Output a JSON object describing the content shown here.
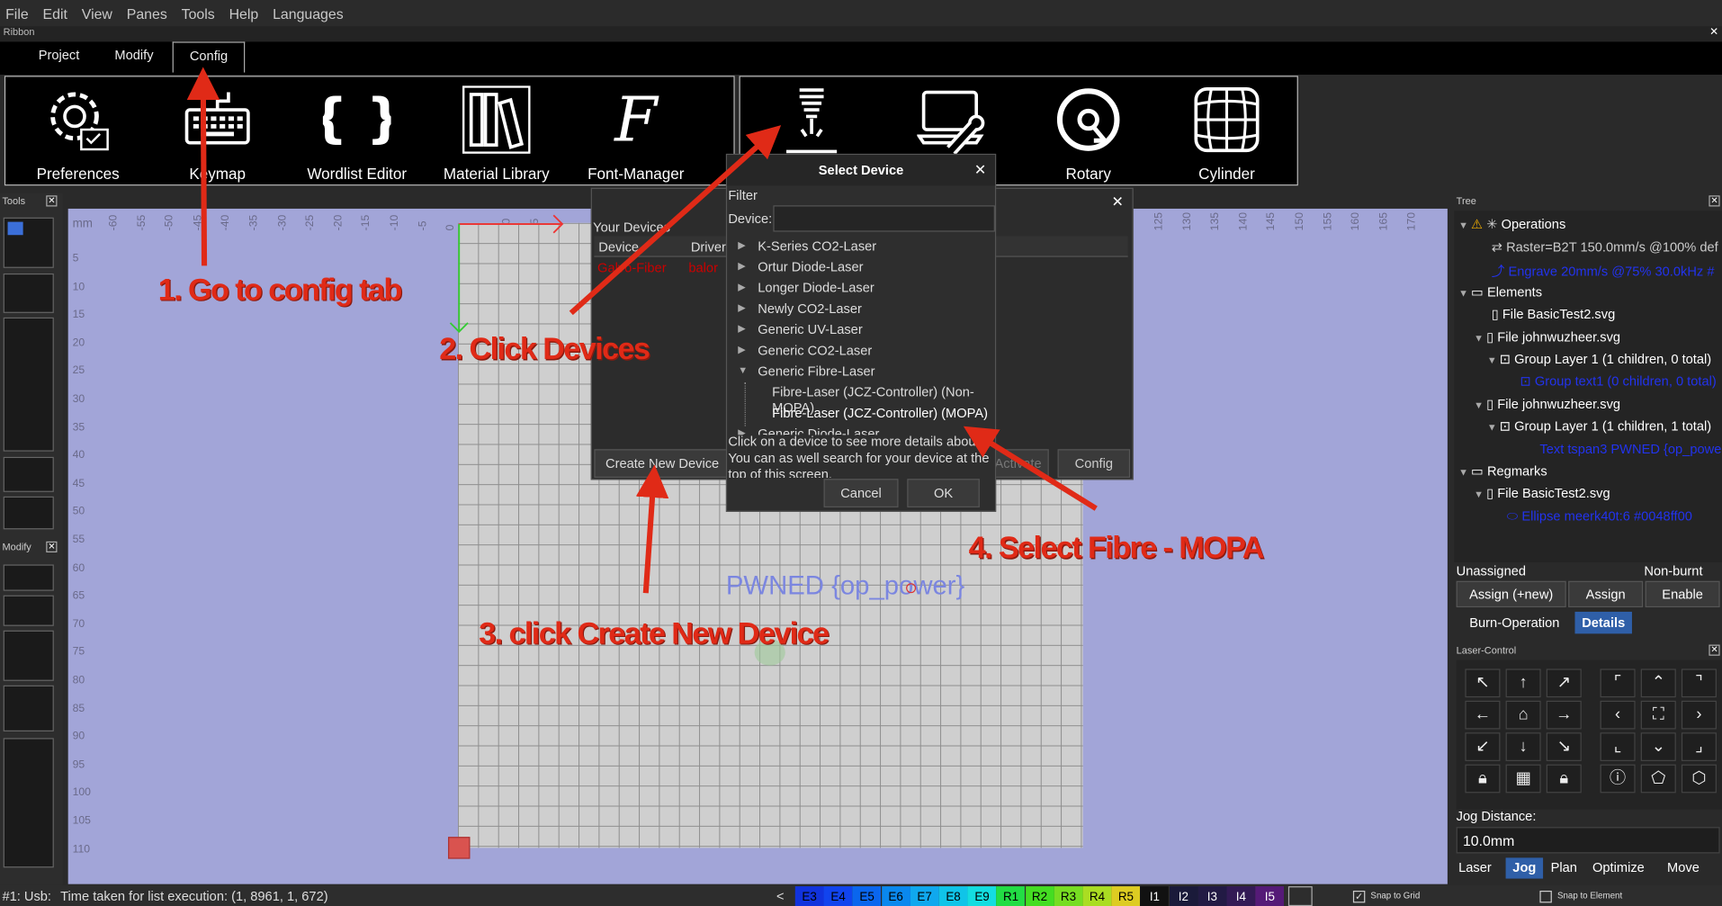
{
  "menu": [
    "File",
    "Edit",
    "View",
    "Panes",
    "Tools",
    "Help",
    "Languages"
  ],
  "ribbon_label": "Ribbon",
  "tabs": [
    "Project",
    "Modify",
    "Config"
  ],
  "ribbon_buttons": [
    "Preferences",
    "Keymap",
    "Wordlist Editor",
    "Material Library",
    "Font-Manager",
    "",
    "Rotary",
    "Cylinder"
  ],
  "tools_label": "Tools",
  "modify_label": "Modify",
  "ruler": {
    "unit": "mm",
    "top": [
      "-60",
      "-55",
      "-50",
      "-45",
      "-40",
      "-35",
      "-30",
      "-25",
      "-20",
      "-15",
      "-10",
      "-5",
      "0",
      "5",
      "10",
      "15",
      "125",
      "130",
      "135",
      "140",
      "145",
      "150",
      "155",
      "160",
      "165",
      "170"
    ],
    "left": [
      "5",
      "10",
      "15",
      "20",
      "25",
      "30",
      "35",
      "40",
      "45",
      "50",
      "55",
      "60",
      "65",
      "70",
      "75",
      "80",
      "85",
      "90",
      "95",
      "100",
      "105",
      "110"
    ]
  },
  "canvas_text": "PWNED {op_power}",
  "devices_dialog": {
    "title": "Your Devices",
    "col_device": "Device",
    "col_driver": "Driver",
    "row_device": "Galvo-Fiber",
    "row_driver": "balor",
    "create_btn": "Create New Device",
    "activate_btn": "Activate",
    "config_btn": "Config"
  },
  "select_dialog": {
    "title": "Select Device",
    "filter": "Filter",
    "device_label": "Device:",
    "items": [
      "K-Series CO2-Laser",
      "Ortur Diode-Laser",
      "Longer Diode-Laser",
      "Newly CO2-Laser",
      "Generic UV-Laser",
      "Generic CO2-Laser",
      "Generic Fibre-Laser"
    ],
    "children": [
      "Fibre-Laser (JCZ-Controller) (Non-MOPA)",
      "Fibre-Laser (JCZ-Controller) (MOPA)"
    ],
    "partial_item": "Generic Diode-Laser",
    "info": "Click on a device to see more details about it. You can as well search for your device at the top of this screen.",
    "cancel": "Cancel",
    "ok": "OK"
  },
  "tree": {
    "label": "Tree",
    "operations": "Operations",
    "op1": "Raster=B2T 150.0mm/s @100% def",
    "op2": "Engrave 20mm/s @75% 30.0kHz #",
    "elements": "Elements",
    "file1": "File BasicTest2.svg",
    "file2": "File johnwuzheer.svg",
    "group1": "Group Layer 1 (1 children, 0 total)",
    "group1child": "Group text1 (0 children, 0 total)",
    "file3": "File johnwuzheer.svg",
    "group2": "Group Layer 1 (1 children, 1 total)",
    "group2child": "Text tspan3 PWNED {op_power}",
    "regmarks": "Regmarks",
    "file4": "File BasicTest2.svg",
    "ellipse": "Ellipse meerk40t:6 #0048ff00"
  },
  "right": {
    "unassigned": "Unassigned",
    "nonburnt": "Non-burnt",
    "assign_new": "Assign (+new)",
    "assign": "Assign",
    "enable": "Enable",
    "tab_burn": "Burn-Operation",
    "tab_details": "Details",
    "laser_control": "Laser-Control",
    "jog_label": "Jog Distance:",
    "jog_value": "10.0mm",
    "bottom_tabs": [
      "Laser",
      "Jog",
      "Plan",
      "Optimize",
      "Move"
    ]
  },
  "status": {
    "prefix": "#1: Usb:",
    "message": "Time taken for list execution: (1, 8961, 1, 672)",
    "lt": "<",
    "snap_grid": "Snap to Grid",
    "snap_element": "Snap to Element"
  },
  "palette": [
    {
      "label": "E3",
      "color": "#1133dd"
    },
    {
      "label": "E4",
      "color": "#1144ee"
    },
    {
      "label": "E5",
      "color": "#0a66ee"
    },
    {
      "label": "E6",
      "color": "#0a88ee"
    },
    {
      "label": "E7",
      "color": "#10a8ee"
    },
    {
      "label": "E8",
      "color": "#10c4e8"
    },
    {
      "label": "E9",
      "color": "#14dde0"
    },
    {
      "label": "R1",
      "color": "#22dd44"
    },
    {
      "label": "R2",
      "color": "#44dd22"
    },
    {
      "label": "R3",
      "color": "#77dd22"
    },
    {
      "label": "R4",
      "color": "#aadd22"
    },
    {
      "label": "R5",
      "color": "#ddcc22"
    },
    {
      "label": "I1",
      "color": "#111111"
    },
    {
      "label": "I2",
      "color": "#1a1a3a"
    },
    {
      "label": "I3",
      "color": "#221a44"
    },
    {
      "label": "I4",
      "color": "#331a55"
    },
    {
      "label": "I5",
      "color": "#551a77"
    }
  ],
  "annotations": [
    "1. Go to config tab",
    "2. Click Devices",
    "3. click Create New Device",
    "4. Select Fibre - MOPA"
  ],
  "colors": {
    "annotation": "#e02a17",
    "canvas_bg": "#a2a5d8",
    "paper": "#cfcfcf",
    "device_red": "#cc0000",
    "link_blue": "#2233ee"
  }
}
